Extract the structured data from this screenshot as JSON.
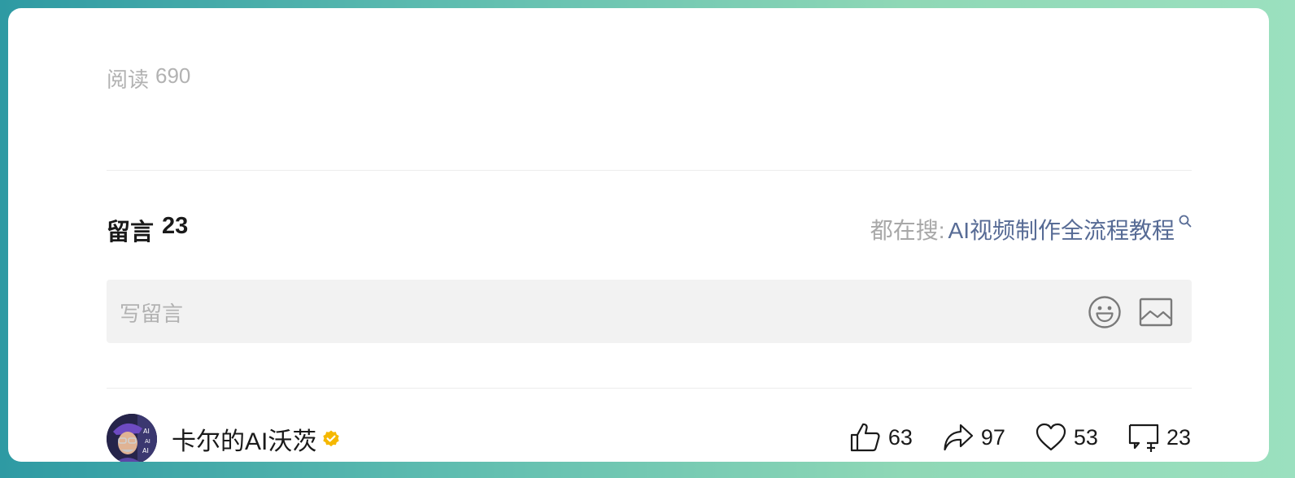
{
  "article": {
    "read_label": "阅读",
    "read_count": "690"
  },
  "comments": {
    "title": "留言",
    "count": "23",
    "search_prefix": "都在搜:",
    "search_term": "AI视频制作全流程教程",
    "input_placeholder": "写留言"
  },
  "author": {
    "name": "卡尔的AI沃茨",
    "verified": true
  },
  "actions": {
    "like_count": "63",
    "share_count": "97",
    "favorite_count": "53",
    "comment_count": "23"
  },
  "icons": {
    "search": "search-icon",
    "emoji": "emoji-icon",
    "image": "image-icon",
    "verified": "verified-badge-icon",
    "like": "thumbs-up-icon",
    "share": "share-arrow-icon",
    "favorite": "heart-icon",
    "comment": "comment-add-icon"
  },
  "colors": {
    "link": "#576b95",
    "muted": "#b2b2b2",
    "verified": "#f5b800"
  }
}
